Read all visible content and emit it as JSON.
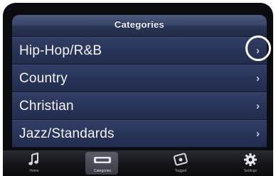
{
  "header": {
    "title": "Categories"
  },
  "categories": [
    {
      "label": "Hip-Hop/R&B",
      "chevron": "›",
      "highlighted": true
    },
    {
      "label": "Country",
      "chevron": "›",
      "highlighted": false
    },
    {
      "label": "Christian",
      "chevron": "›",
      "highlighted": false
    },
    {
      "label": "Jazz/Standards",
      "chevron": "›",
      "highlighted": false
    }
  ],
  "tabbar": {
    "tabs": [
      {
        "label": "Home",
        "icon": "music-note-icon",
        "active": false
      },
      {
        "label": "Categories",
        "icon": "categories-icon",
        "active": true
      },
      {
        "label": "Tagged",
        "icon": "tagged-icon",
        "active": false
      },
      {
        "label": "Settings",
        "icon": "gear-icon",
        "active": false
      }
    ]
  },
  "colors": {
    "header_blue": "#38456a",
    "row_blue": "#283457",
    "highlight": "#ffffff"
  }
}
